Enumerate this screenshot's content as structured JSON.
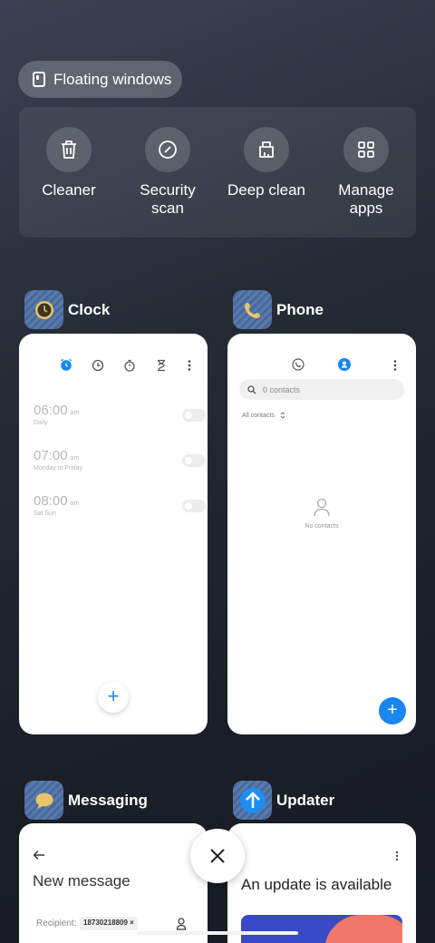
{
  "floating_windows": {
    "label": "Floating windows"
  },
  "tools": [
    {
      "label": "Cleaner",
      "icon": "trash-icon"
    },
    {
      "label": "Security\nscan",
      "icon": "security-scan-icon"
    },
    {
      "label": "Deep clean",
      "icon": "deep-clean-icon"
    },
    {
      "label": "Manage\napps",
      "icon": "grid-apps-icon"
    }
  ],
  "apps": {
    "clock": {
      "name": "Clock",
      "alarms": [
        {
          "time": "06:00",
          "ampm": "am",
          "days": "Daily"
        },
        {
          "time": "07:00",
          "ampm": "am",
          "days": "Monday to Friday"
        },
        {
          "time": "08:00",
          "ampm": "am",
          "days": "Sat Sun"
        }
      ],
      "fab": "+"
    },
    "phone": {
      "name": "Phone",
      "search_placeholder": "0 contacts",
      "filter": "All contacts",
      "empty": "No contacts",
      "fab": "+"
    },
    "messaging": {
      "name": "Messaging",
      "title": "New message",
      "recipient_label": "Recipient:",
      "recipient_chip": "18730218809 ×"
    },
    "updater": {
      "name": "Updater",
      "title": "An update is available"
    }
  },
  "colors": {
    "accent": "#1a86ef",
    "updater_red": "#f0776a",
    "updater_blue": "#3a49c8"
  }
}
